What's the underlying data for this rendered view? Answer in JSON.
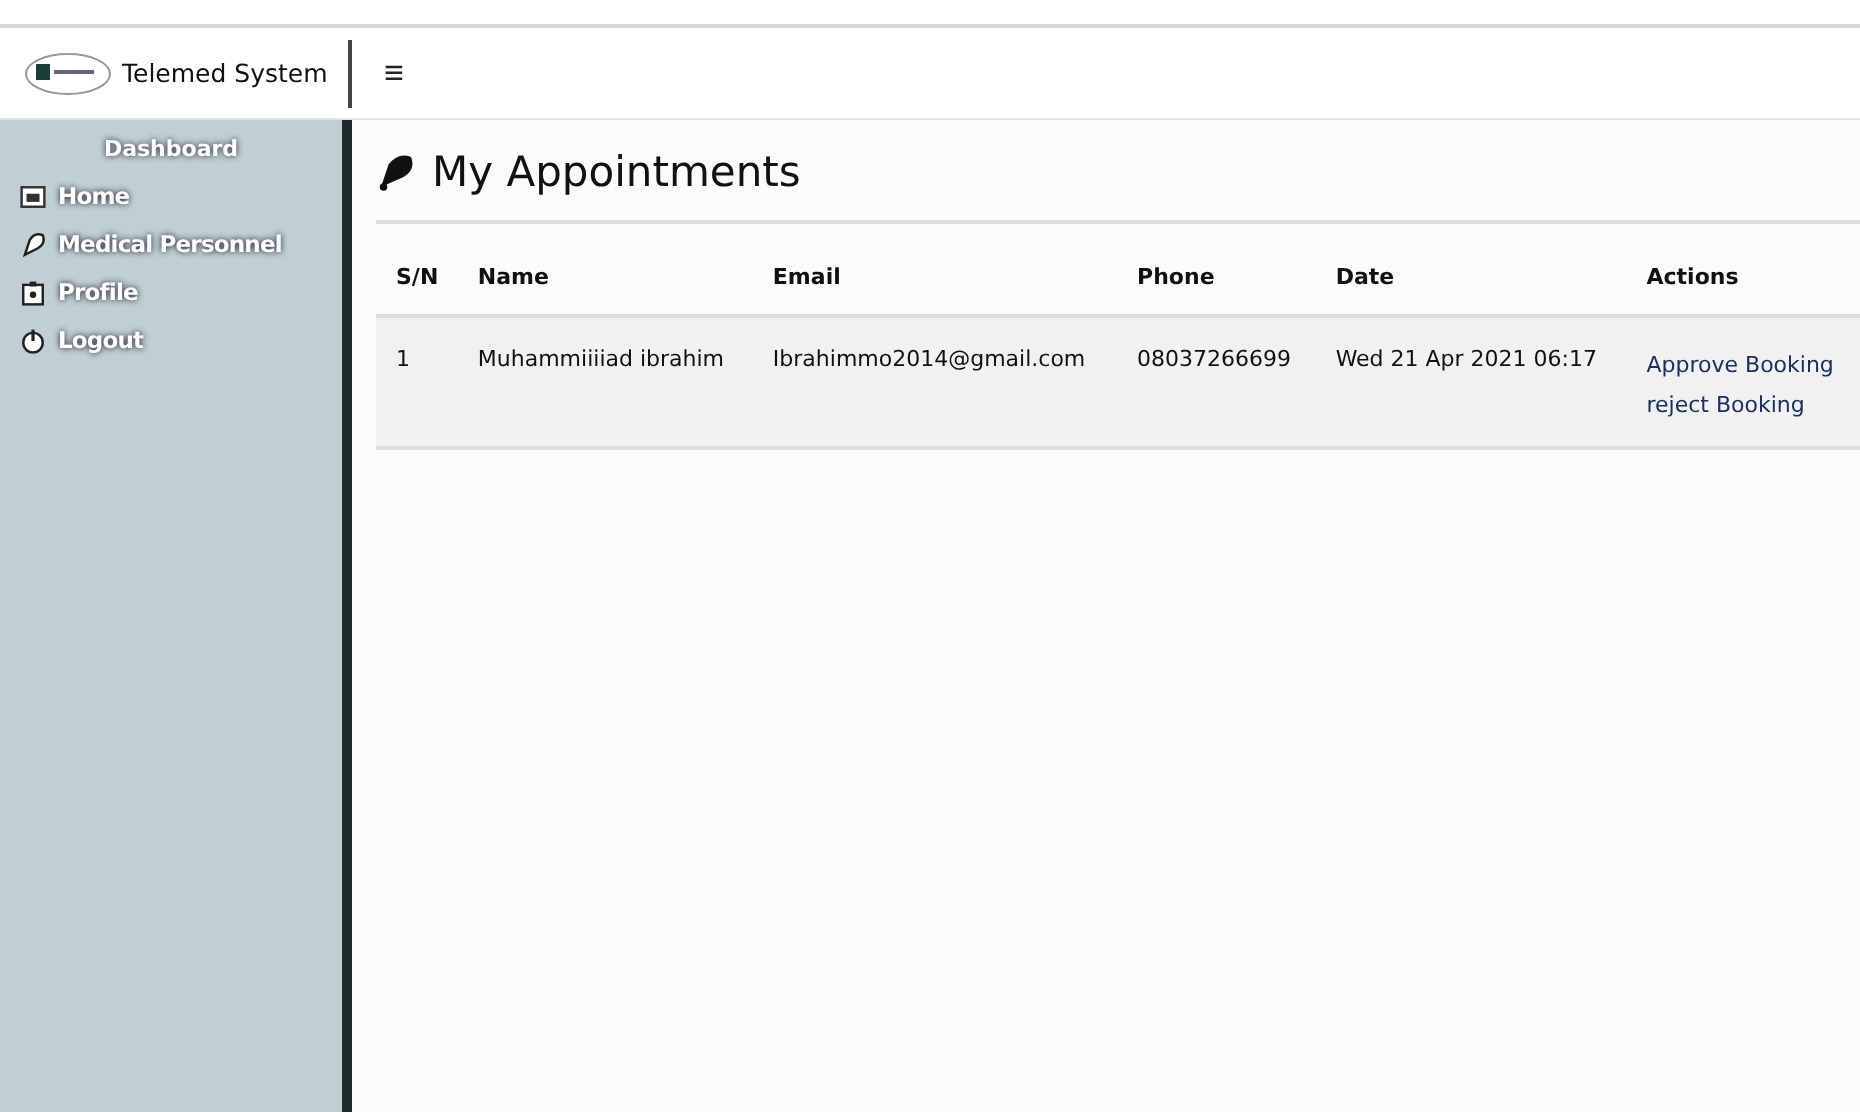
{
  "brand": {
    "title": "Telemed System"
  },
  "menu_toggle": "≡",
  "sidebar": {
    "heading": "Dashboard",
    "items": [
      {
        "label": "Home"
      },
      {
        "label": "Medical Personnel"
      },
      {
        "label": "Profile"
      },
      {
        "label": "Logout"
      }
    ]
  },
  "page": {
    "title": "My Appointments"
  },
  "table": {
    "columns": [
      "S/N",
      "Name",
      "Email",
      "Phone",
      "Date",
      "Actions"
    ],
    "rows": [
      {
        "cells": [
          "1",
          "Muhammiiiiad ibrahim",
          "Ibrahimmo2014@gmail.com",
          "08037266699",
          "Wed 21 Apr 2021 06:17"
        ],
        "actions": [
          "Approve Booking",
          "reject Booking"
        ]
      }
    ]
  }
}
